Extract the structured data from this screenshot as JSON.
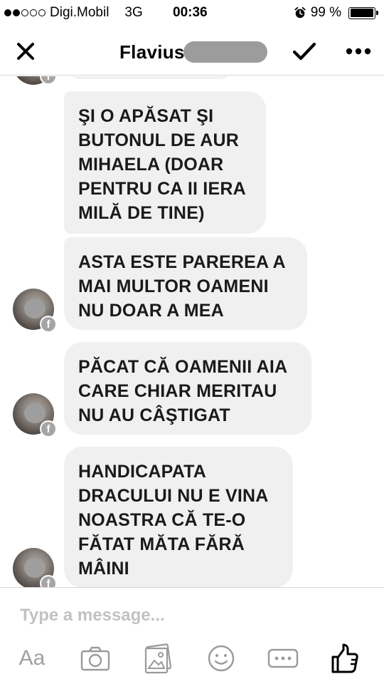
{
  "status_bar": {
    "signal_filled": 2,
    "signal_total": 5,
    "carrier": "Digi.Mobil",
    "network": "3G",
    "time": "00:36",
    "battery": "99 %",
    "battery_level": 0.99
  },
  "header": {
    "title": "Flavius",
    "icons": {
      "close": "close-icon",
      "confirm": "checkmark-icon",
      "more": "more-icon"
    }
  },
  "messages": [
    {
      "text": "ŞI O APĂSAT ŞI\nBUTONUL DE AUR\nMIHAELA (DOAR\nPENTRU CA II IERA\nMILĂ DE TINE)",
      "avatar": false
    },
    {
      "text": "ASTA ESTE PAREREA A\nMAI MULTOR OAMENI\nNU DOAR A MEA",
      "avatar": true
    },
    {
      "text": "PĂCAT CĂ OAMENII AIA\nCARE CHIAR MERITAU\nNU AU CÂŞTIGAT",
      "avatar": true
    },
    {
      "text": "HANDICAPATA\nDRACULUI NU E VINA\nNOASTRA CĂ TE-O\nFĂTAT MĂTA FĂRĂ\nMÂINI",
      "avatar": true
    }
  ],
  "composer": {
    "placeholder": "Type a message...",
    "text_tool_label": "Aa",
    "tools": [
      "text-format-icon",
      "camera-icon",
      "gallery-icon",
      "emoji-icon",
      "more-options-icon",
      "thumbs-up-icon"
    ]
  },
  "colors": {
    "bubble_bg": "#f1f0f0",
    "icon_gray": "#9a9a9a",
    "divider": "#d9d9d9"
  }
}
